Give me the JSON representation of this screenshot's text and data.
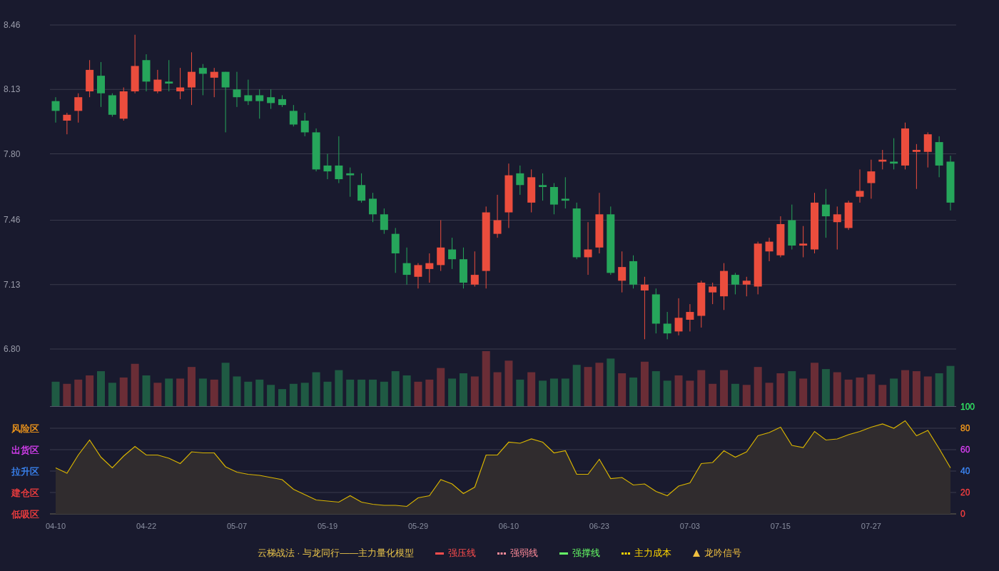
{
  "price_chart": {
    "chart_data": {
      "type": "candlestick",
      "grid": true,
      "ylim": [
        6.8,
        8.46
      ],
      "yticks": [
        {
          "value": 8.46,
          "label": "8.46"
        },
        {
          "value": 8.13,
          "label": "8.13"
        },
        {
          "value": 7.8,
          "label": "7.80"
        },
        {
          "value": 7.46,
          "label": "7.46"
        },
        {
          "value": 7.13,
          "label": "7.13"
        },
        {
          "value": 6.8,
          "label": "6.80"
        }
      ],
      "ohlc": [
        [
          8.07,
          8.09,
          7.96,
          8.02
        ],
        [
          7.97,
          8.01,
          7.9,
          8.0
        ],
        [
          8.02,
          8.11,
          7.96,
          8.09
        ],
        [
          8.12,
          8.28,
          8.09,
          8.23
        ],
        [
          8.2,
          8.27,
          8.04,
          8.11
        ],
        [
          8.1,
          8.11,
          7.99,
          8.0
        ],
        [
          7.98,
          8.14,
          7.97,
          8.12
        ],
        [
          8.12,
          8.41,
          8.11,
          8.25
        ],
        [
          8.28,
          8.31,
          8.12,
          8.17
        ],
        [
          8.12,
          8.23,
          8.11,
          8.18
        ],
        [
          8.17,
          8.28,
          8.12,
          8.16
        ],
        [
          8.12,
          8.24,
          8.08,
          8.14
        ],
        [
          8.14,
          8.32,
          8.05,
          8.22
        ],
        [
          8.24,
          8.26,
          8.1,
          8.21
        ],
        [
          8.19,
          8.24,
          8.09,
          8.22
        ],
        [
          8.22,
          8.22,
          7.91,
          8.14
        ],
        [
          8.13,
          8.22,
          8.04,
          8.09
        ],
        [
          8.1,
          8.18,
          8.05,
          8.07
        ],
        [
          8.1,
          8.13,
          7.98,
          8.07
        ],
        [
          8.09,
          8.13,
          8.03,
          8.06
        ],
        [
          8.08,
          8.1,
          8.04,
          8.05
        ],
        [
          8.02,
          8.05,
          7.94,
          7.95
        ],
        [
          7.97,
          8.01,
          7.89,
          7.91
        ],
        [
          7.91,
          7.93,
          7.71,
          7.72
        ],
        [
          7.74,
          7.8,
          7.67,
          7.71
        ],
        [
          7.74,
          7.89,
          7.65,
          7.67
        ],
        [
          7.7,
          7.73,
          7.58,
          7.69
        ],
        [
          7.64,
          7.7,
          7.55,
          7.56
        ],
        [
          7.57,
          7.6,
          7.45,
          7.49
        ],
        [
          7.49,
          7.52,
          7.39,
          7.41
        ],
        [
          7.39,
          7.42,
          7.19,
          7.29
        ],
        [
          7.24,
          7.32,
          7.13,
          7.18
        ],
        [
          7.17,
          7.24,
          7.11,
          7.23
        ],
        [
          7.21,
          7.29,
          7.14,
          7.24
        ],
        [
          7.23,
          7.46,
          7.2,
          7.32
        ],
        [
          7.31,
          7.37,
          7.21,
          7.26
        ],
        [
          7.26,
          7.32,
          7.11,
          7.14
        ],
        [
          7.13,
          7.3,
          7.12,
          7.18
        ],
        [
          7.2,
          7.53,
          7.11,
          7.5
        ],
        [
          7.39,
          7.59,
          7.37,
          7.46
        ],
        [
          7.5,
          7.75,
          7.42,
          7.69
        ],
        [
          7.7,
          7.74,
          7.59,
          7.64
        ],
        [
          7.55,
          7.72,
          7.5,
          7.68
        ],
        [
          7.64,
          7.7,
          7.56,
          7.63
        ],
        [
          7.63,
          7.65,
          7.49,
          7.54
        ],
        [
          7.57,
          7.68,
          7.52,
          7.56
        ],
        [
          7.52,
          7.55,
          7.26,
          7.27
        ],
        [
          7.27,
          7.45,
          7.18,
          7.31
        ],
        [
          7.32,
          7.6,
          7.29,
          7.49
        ],
        [
          7.49,
          7.53,
          7.18,
          7.19
        ],
        [
          7.15,
          7.3,
          7.09,
          7.22
        ],
        [
          7.25,
          7.28,
          7.11,
          7.13
        ],
        [
          7.1,
          7.17,
          6.85,
          7.13
        ],
        [
          7.08,
          7.11,
          6.88,
          6.93
        ],
        [
          6.93,
          6.99,
          6.85,
          6.88
        ],
        [
          6.89,
          7.06,
          6.87,
          6.96
        ],
        [
          6.95,
          7.03,
          6.89,
          6.99
        ],
        [
          6.97,
          7.15,
          6.91,
          7.14
        ],
        [
          7.09,
          7.14,
          7.03,
          7.12
        ],
        [
          7.07,
          7.24,
          7.0,
          7.2
        ],
        [
          7.18,
          7.19,
          7.08,
          7.13
        ],
        [
          7.13,
          7.17,
          7.07,
          7.15
        ],
        [
          7.12,
          7.35,
          7.08,
          7.34
        ],
        [
          7.3,
          7.37,
          7.25,
          7.35
        ],
        [
          7.28,
          7.48,
          7.27,
          7.44
        ],
        [
          7.46,
          7.54,
          7.31,
          7.33
        ],
        [
          7.33,
          7.43,
          7.27,
          7.34
        ],
        [
          7.31,
          7.6,
          7.29,
          7.55
        ],
        [
          7.54,
          7.62,
          7.37,
          7.48
        ],
        [
          7.45,
          7.53,
          7.31,
          7.49
        ],
        [
          7.42,
          7.56,
          7.41,
          7.55
        ],
        [
          7.58,
          7.72,
          7.55,
          7.61
        ],
        [
          7.65,
          7.77,
          7.57,
          7.71
        ],
        [
          7.76,
          7.82,
          7.72,
          7.77
        ],
        [
          7.76,
          7.88,
          7.72,
          7.75
        ],
        [
          7.74,
          7.96,
          7.72,
          7.93
        ],
        [
          7.81,
          7.85,
          7.62,
          7.82
        ],
        [
          7.81,
          7.91,
          7.73,
          7.9
        ],
        [
          7.86,
          7.89,
          7.68,
          7.74
        ],
        [
          7.76,
          7.79,
          7.51,
          7.55
        ]
      ]
    }
  },
  "oscillator": {
    "zones": [
      {
        "label": "风险区",
        "color": "#ff9f1a"
      },
      {
        "label": "出货区",
        "color": "#e040fb"
      },
      {
        "label": "拉升区",
        "color": "#3d8bff"
      },
      {
        "label": "建仓区",
        "color": "#ff4040"
      },
      {
        "label": "低吸区",
        "color": "#ff4040"
      }
    ],
    "scale_labels": [
      {
        "color": "#33ee66"
      },
      {
        "color": "#ff9f1a"
      },
      {
        "color": "#e040fb"
      },
      {
        "color": "#3d8bff"
      },
      {
        "color": "#ff4040"
      },
      {
        "color": "#ff4040"
      }
    ],
    "chart_data": {
      "type": "area",
      "grid": true,
      "ylim": [
        0,
        100
      ],
      "yticks": [
        100,
        80,
        60,
        40,
        20,
        0
      ],
      "categories": [
        "04-10",
        null,
        null,
        null,
        null,
        null,
        null,
        null,
        "04-22",
        null,
        null,
        null,
        null,
        null,
        null,
        null,
        "05-07",
        null,
        null,
        null,
        null,
        null,
        null,
        null,
        "05-19",
        null,
        null,
        null,
        null,
        null,
        null,
        null,
        "05-29",
        null,
        null,
        null,
        null,
        null,
        null,
        null,
        "06-10",
        null,
        null,
        null,
        null,
        null,
        null,
        null,
        "06-23",
        null,
        null,
        null,
        null,
        null,
        null,
        null,
        "07-03",
        null,
        null,
        null,
        null,
        null,
        null,
        null,
        "07-15",
        null,
        null,
        null,
        null,
        null,
        null,
        null,
        "07-27",
        null,
        null,
        null,
        null,
        null,
        null,
        null
      ],
      "series": [
        {
          "color": "#d8b400",
          "values": [
            43,
            38,
            55,
            69,
            53,
            43,
            54,
            63,
            55,
            55,
            52,
            47,
            58,
            57,
            57,
            44,
            39,
            37,
            36,
            34,
            32,
            23,
            18,
            13,
            12,
            11,
            17,
            11,
            9,
            8,
            8,
            7,
            15,
            17,
            32,
            28,
            19,
            25,
            55,
            55,
            67,
            66,
            70,
            67,
            57,
            59,
            37,
            37,
            51,
            33,
            34,
            27,
            28,
            21,
            17,
            26,
            29,
            47,
            48,
            59,
            53,
            58,
            73,
            76,
            81,
            64,
            62,
            77,
            69,
            70,
            74,
            77,
            81,
            84,
            80,
            87,
            73,
            78,
            61,
            43
          ]
        }
      ]
    }
  },
  "legend": {
    "title": "云梯战法 · 与龙同行——主力量化模型",
    "items": [
      {
        "label": "强压线",
        "kind": "solid",
        "color": "#ff4d4d"
      },
      {
        "label": "强弱线",
        "kind": "dashed",
        "color": "#ff8c9a"
      },
      {
        "label": "强撑线",
        "kind": "solid",
        "color": "#66ff66"
      },
      {
        "label": "主力成本",
        "kind": "dashed",
        "color": "#ffd700"
      },
      {
        "label": "龙吟信号",
        "kind": "triangle",
        "color": "#f0c040"
      }
    ]
  }
}
